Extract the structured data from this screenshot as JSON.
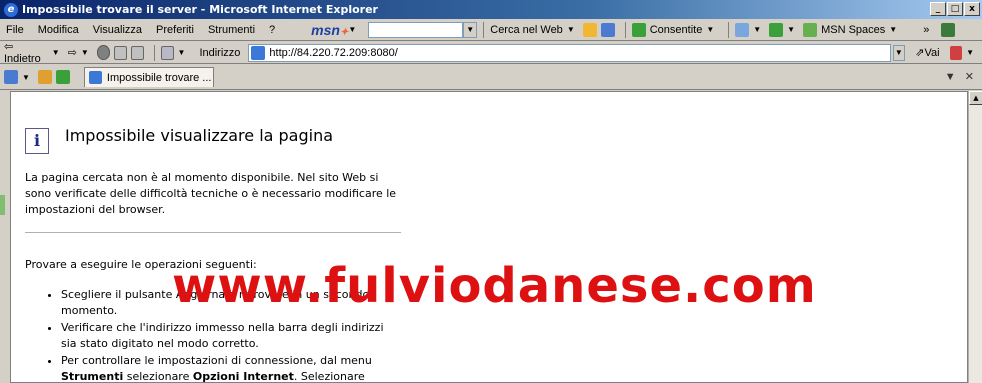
{
  "window": {
    "title": "Impossibile trovare il server - Microsoft Internet Explorer"
  },
  "menu": [
    "File",
    "Modifica",
    "Visualizza",
    "Preferiti",
    "Strumenti",
    "?"
  ],
  "msn_toolbar": {
    "logo": "msn",
    "search_label": "Cerca nel Web",
    "allow_label": "Consentite",
    "spaces_label": "MSN Spaces"
  },
  "address": {
    "back_label": "Indietro",
    "label": "Indirizzo",
    "url": "http://84.220.72.209:8080/",
    "go_label": "Vai"
  },
  "tabs": [
    {
      "label": "Impossibile trovare ..."
    }
  ],
  "page": {
    "heading": "Impossibile visualizzare la pagina",
    "paragraph": "La pagina cercata non è al momento disponibile. Nel sito Web si sono verificate delle difficoltà tecniche o è necessario modificare le impostazioni del browser.",
    "try_text": "Provare a eseguire le operazioni seguenti:",
    "bullet1": "Scegliere il pulsante Aggiorna o riprovare in un secondo momento.",
    "bullet2": "Verificare che l'indirizzo immesso nella barra degli indirizzi sia stato digitato nel modo corretto.",
    "bullet3_prefix": "Per controllare le impostazioni di connessione, dal menu",
    "bullet3_bold1": "Strumenti",
    "bullet3_mid": " selezionare ",
    "bullet3_bold2": "Opzioni Internet",
    "bullet3_suffix": ". Selezionare"
  },
  "watermark": "www.fulviodanese.com",
  "colors": {
    "watermark": "#dd1111",
    "titlebar": "#0a246a"
  }
}
